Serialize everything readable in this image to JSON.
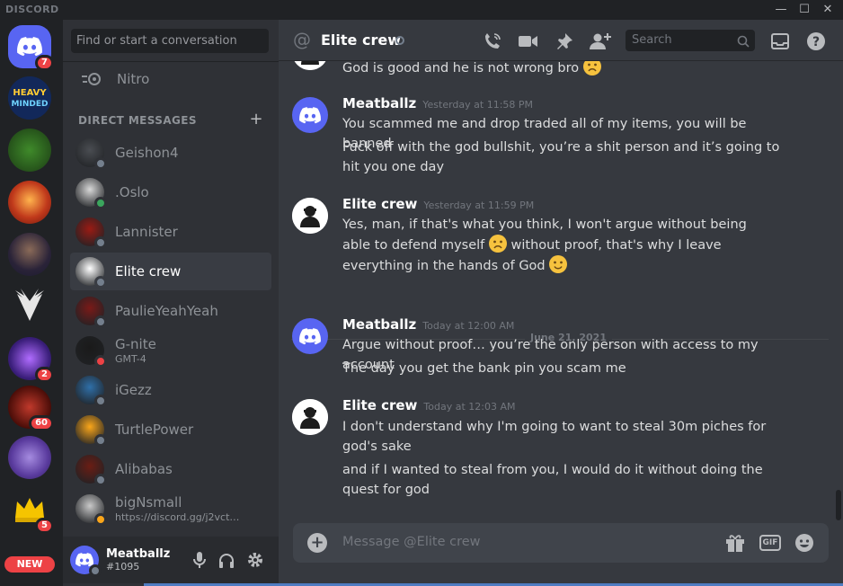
{
  "window": {
    "brand": "DISCORD",
    "controls": {
      "minimize": "—",
      "maximize": "☐",
      "close": "✕"
    }
  },
  "guilds": {
    "home_badge": "7",
    "items": [
      {
        "name": "HEAVY MINDED",
        "label": "HEAVY\nMINDED",
        "badge": ""
      },
      {
        "name": "green-server",
        "badge": ""
      },
      {
        "name": "red-demon-server",
        "badge": ""
      },
      {
        "name": "bearded-avatar-server",
        "badge": ""
      },
      {
        "name": "wings-server",
        "badge": ""
      },
      {
        "name": "purple-box-server",
        "badge": "2"
      },
      {
        "name": "red-server",
        "badge": "60"
      },
      {
        "name": "purple-flower-server",
        "badge": ""
      },
      {
        "name": "crown-server",
        "badge": "5"
      }
    ],
    "new_label": "NEW"
  },
  "sidebar": {
    "search_placeholder": "Find or start a conversation",
    "nitro_label": "Nitro",
    "dm_header": "DIRECT MESSAGES",
    "dm_add": "+",
    "dms": [
      {
        "name": "Geishon4",
        "status": "offline",
        "sub": "",
        "avatar_color": "#4a4d52"
      },
      {
        "name": ".Oslo",
        "status": "online",
        "sub": "",
        "avatar_color": "#d8d8d8"
      },
      {
        "name": "Lannister",
        "status": "offline",
        "sub": "",
        "avatar_color": "#9a1b14"
      },
      {
        "name": "Elite crew",
        "status": "offline",
        "sub": "",
        "avatar_color": "#ffffff",
        "active": true
      },
      {
        "name": "PaulieYeahYeah",
        "status": "offline",
        "sub": "",
        "avatar_color": "#7a1a18"
      },
      {
        "name": "G-nite",
        "status": "dnd",
        "sub": "GMT-4",
        "avatar_color": "#1a1a1a"
      },
      {
        "name": "iGezz",
        "status": "offline",
        "sub": "",
        "avatar_color": "#2f6fa8"
      },
      {
        "name": "TurtlePower",
        "status": "offline",
        "sub": "",
        "avatar_color": "#faa61a"
      },
      {
        "name": "Alibabas",
        "status": "offline",
        "sub": "",
        "avatar_color": "#6a1d14"
      },
      {
        "name": "bigNsmall",
        "status": "idle",
        "sub": "https://discord.gg/j2vct…",
        "avatar_color": "#c9c9c9"
      }
    ]
  },
  "user_panel": {
    "username": "Meatballz",
    "tag": "#1095"
  },
  "chat": {
    "at_symbol": "@",
    "title": "Elite crew",
    "search_placeholder": "Search",
    "date_divider": "June 21, 2021",
    "partial_text": "God is good and he is not wrong bro",
    "groups": [
      {
        "author": "Meatballz",
        "timestamp": "Yesterday at 11:58 PM",
        "avatar": "discord",
        "lines": [
          "You scammed me and drop traded all of my items, you will be banned",
          "Fuck off with the god bullshit, you’re a shit person and it’s going to hit you one day"
        ]
      },
      {
        "author": "Elite crew",
        "timestamp": "Yesterday at 11:59 PM",
        "avatar": "elite",
        "lines": [
          "Yes, man, if that's what you think, I won't argue without being able to defend myself",
          "without proof, that's why I leave everything in the hands of God"
        ]
      },
      {
        "author": "Meatballz",
        "timestamp": "Today at 12:00 AM",
        "avatar": "discord",
        "lines": [
          "Argue without proof… you’re the only person with access to my account",
          "The day you get the bank pin you scam me"
        ]
      },
      {
        "author": "Elite crew",
        "timestamp": "Today at 12:03 AM",
        "avatar": "elite",
        "lines": [
          "I don't understand why I'm going to want to steal 30m piches for god's sake",
          "and if I wanted to steal from you, I would do it without doing the quest for god"
        ]
      }
    ],
    "composer_placeholder": "Message @Elite crew",
    "gif_label": "GIF"
  },
  "colors": {
    "blurple": "#5865f2",
    "online": "#3ba55d",
    "dnd": "#ed4245",
    "offline": "#747f8d",
    "idle": "#faa61a"
  }
}
